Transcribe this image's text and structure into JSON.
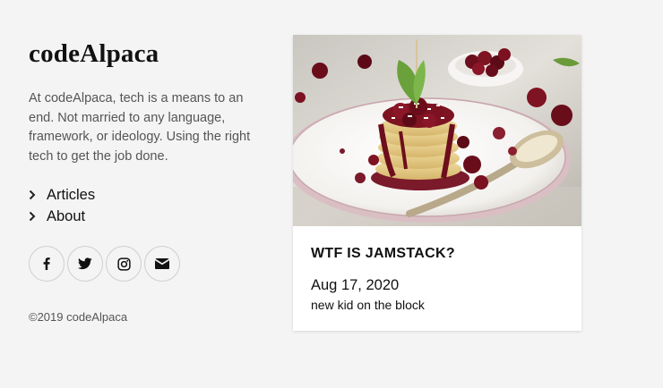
{
  "site": {
    "title": "codeAlpaca",
    "tagline": "At codeAlpaca, tech is a means to an end. Not married to any language, framework, or ideology. Using the right tech to get the job done.",
    "copyright": "©2019 codeAlpaca"
  },
  "nav": {
    "items": [
      {
        "label": "Articles",
        "icon": "chevron-right-icon"
      },
      {
        "label": "About",
        "icon": "chevron-right-icon"
      }
    ]
  },
  "social": [
    {
      "name": "facebook",
      "icon": "facebook-icon"
    },
    {
      "name": "twitter",
      "icon": "twitter-icon"
    },
    {
      "name": "instagram",
      "icon": "instagram-icon"
    },
    {
      "name": "email",
      "icon": "envelope-icon"
    }
  ],
  "post": {
    "title": "WTF IS JAMSTACK?",
    "date": "Aug 17, 2020",
    "excerpt": "new kid on the block",
    "image": "pancake-stack-with-cherries-photo"
  },
  "colors": {
    "background": "#f4f4f4",
    "text": "#111111",
    "muted": "#555555",
    "card": "#ffffff"
  }
}
